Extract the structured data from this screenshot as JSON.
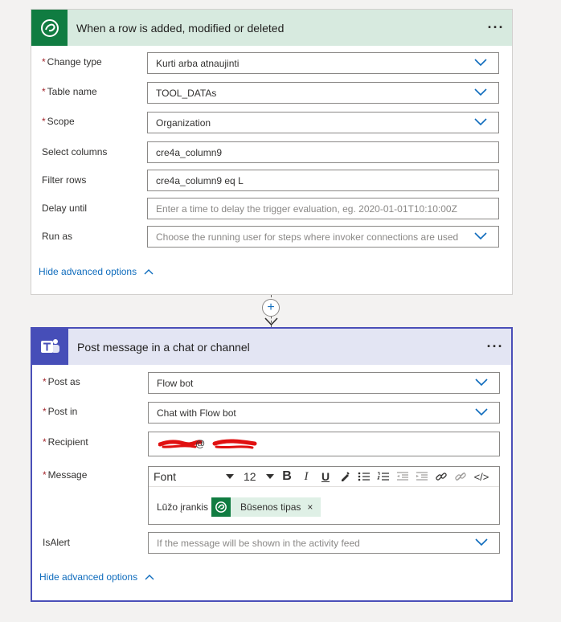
{
  "trigger": {
    "title": "When a row is added, modified or deleted",
    "more_icon": "more-horizontal-icon",
    "app_icon": "dataverse-icon",
    "fields": [
      {
        "label": "Change type",
        "required": true,
        "value": "Kurti arba atnaujinti",
        "type": "dropdown"
      },
      {
        "label": "Table name",
        "required": true,
        "value": "TOOL_DATAs",
        "type": "dropdown"
      },
      {
        "label": "Scope",
        "required": true,
        "value": "Organization",
        "type": "dropdown"
      },
      {
        "label": "Select columns",
        "required": false,
        "value": "cre4a_column9",
        "type": "text"
      },
      {
        "label": "Filter rows",
        "required": false,
        "value": "cre4a_column9 eq L",
        "type": "text"
      },
      {
        "label": "Delay until",
        "required": false,
        "placeholder": "Enter a time to delay the trigger evaluation, eg. 2020-01-01T10:10:00Z",
        "type": "text"
      },
      {
        "label": "Run as",
        "required": false,
        "placeholder": "Choose the running user for steps where invoker connections are used",
        "type": "dropdown"
      }
    ],
    "advanced_link": "Hide advanced options"
  },
  "connector": {
    "add_icon": "plus-icon"
  },
  "action": {
    "title": "Post message in a chat or channel",
    "more_icon": "more-horizontal-icon",
    "app_icon": "teams-icon",
    "post_as": {
      "label": "Post as",
      "value": "Flow bot"
    },
    "post_in": {
      "label": "Post in",
      "value": "Chat with Flow bot"
    },
    "recipient": {
      "label": "Recipient",
      "value": "@"
    },
    "message": {
      "label": "Message",
      "toolbar": {
        "font": "Font",
        "size": "12",
        "bold": "B",
        "italic": "I",
        "underline": "U",
        "code": "</>"
      },
      "text": "Lūžo įrankis",
      "token": "Būsenos tipas",
      "token_remove": "×"
    },
    "isalert": {
      "label": "IsAlert",
      "placeholder": "If the message will be shown in the activity feed"
    },
    "advanced_link": "Hide advanced options"
  },
  "required_marker": "*",
  "colors": {
    "accent": "#0f6cbd",
    "dataverse": "#107c41",
    "teams": "#464eb8",
    "required": "#a4262c"
  }
}
